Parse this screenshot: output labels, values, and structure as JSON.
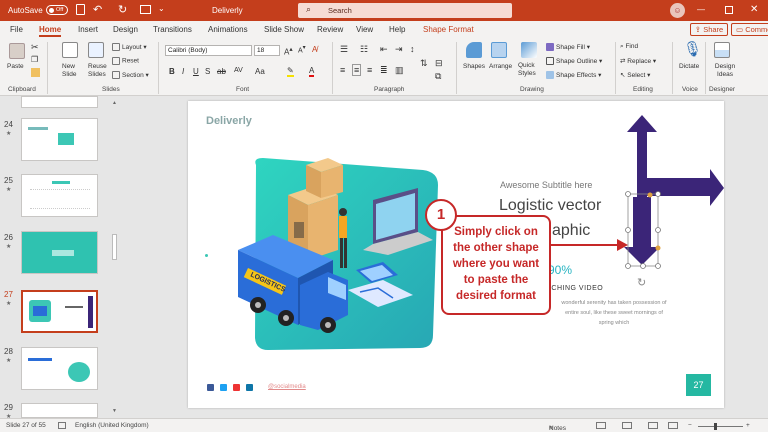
{
  "titlebar": {
    "autosave_label": "AutoSave",
    "autosave_state": "Off",
    "doc_title": "Deliverly",
    "search_placeholder": "Search"
  },
  "tabs": [
    "File",
    "Home",
    "Insert",
    "Design",
    "Transitions",
    "Animations",
    "Slide Show",
    "Review",
    "View",
    "Help",
    "Shape Format"
  ],
  "active_tab": "Home",
  "share_label": "Share",
  "comments_label": "Comments",
  "ribbon": {
    "clipboard": {
      "paste": "Paste",
      "label": "Clipboard"
    },
    "slides": {
      "new_slide": "New Slide",
      "reuse_slides": "Reuse Slides",
      "layout": "Layout",
      "reset": "Reset",
      "section": "Section",
      "label": "Slides"
    },
    "font": {
      "name": "Calibri (Body)",
      "size": "18",
      "label": "Font"
    },
    "paragraph": {
      "label": "Paragraph"
    },
    "drawing": {
      "shapes": "Shapes",
      "arrange": "Arrange",
      "quick_styles": "Quick Styles",
      "shape_fill": "Shape Fill",
      "shape_outline": "Shape Outline",
      "shape_effects": "Shape Effects",
      "label": "Drawing"
    },
    "editing": {
      "find": "Find",
      "replace": "Replace",
      "select": "Select",
      "label": "Editing"
    },
    "voice": {
      "dictate": "Dictate",
      "label": "Voice"
    },
    "designer": {
      "design_ideas": "Design Ideas",
      "label": "Designer"
    }
  },
  "thumbnails": [
    {
      "num": "24",
      "current": false
    },
    {
      "num": "25",
      "current": false
    },
    {
      "num": "26",
      "current": false
    },
    {
      "num": "27",
      "current": true
    },
    {
      "num": "28",
      "current": false
    },
    {
      "num": "29",
      "current": false
    }
  ],
  "slide": {
    "brand": "Deliverly",
    "subtitle": "Awesome Subtitle here",
    "headline_1": "Logistic vector",
    "headline_2": "aphic",
    "percent": "90%",
    "watch": "ATCHING VIDEO",
    "body_1": "wonderful serenity has taken possession of",
    "body_2": "entire soul, like these sweet mornings of",
    "body_3": "spring which",
    "url": "@socialmedia",
    "page_number": "27",
    "truck_text": "LOGISTICS"
  },
  "callout": {
    "number": "1",
    "line1": "Simply click on",
    "line2": "the other shape",
    "line3": "where you want",
    "line4": "to paste the",
    "line5": "desired format"
  },
  "status": {
    "slide_info": "Slide 27 of 55",
    "language": "English (United Kingdom)",
    "notes": "Notes"
  },
  "colors": {
    "accent": "#c43e1c",
    "arrow": "#3b2578",
    "callout": "#c62828",
    "teal": "#25b8a2"
  }
}
